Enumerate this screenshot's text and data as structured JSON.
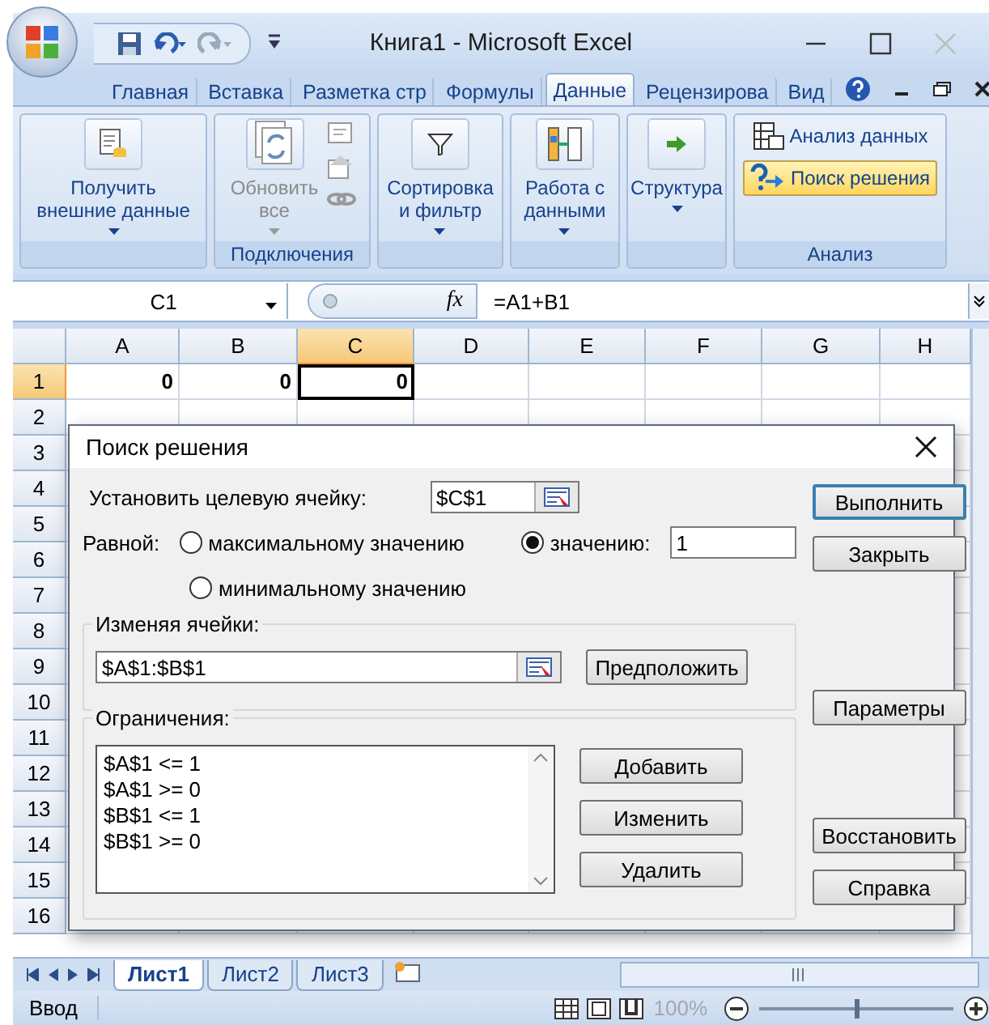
{
  "window": {
    "title": "Книга1 - Microsoft Excel"
  },
  "ribbon_tabs": [
    {
      "label": "Главная",
      "selected": false
    },
    {
      "label": "Вставка",
      "selected": false
    },
    {
      "label": "Разметка стр",
      "selected": false
    },
    {
      "label": "Формулы",
      "selected": false
    },
    {
      "label": "Данные",
      "selected": true
    },
    {
      "label": "Рецензирова",
      "selected": false
    },
    {
      "label": "Вид",
      "selected": false
    }
  ],
  "ribbon_groups": [
    {
      "items": [
        {
          "kind": "large",
          "label": "Получить\nвнешние данные",
          "dropdown": true,
          "disabled": false
        }
      ]
    },
    {
      "label": "Подключения",
      "items": [
        {
          "kind": "large",
          "label": "Обновить\nвсе",
          "dropdown": true,
          "disabled": true
        },
        {
          "kind": "icons"
        }
      ]
    },
    {
      "items": [
        {
          "kind": "large",
          "label": "Сортировка\nи фильтр",
          "dropdown": true,
          "disabled": false
        }
      ]
    },
    {
      "items": [
        {
          "kind": "large",
          "label": "Работа с\nданными",
          "dropdown": true,
          "disabled": false
        }
      ]
    },
    {
      "items": [
        {
          "kind": "large",
          "label": "Структура",
          "dropdown": true,
          "disabled": false
        }
      ]
    },
    {
      "label": "Анализ",
      "items": [
        {
          "kind": "small",
          "label": "Анализ данных",
          "highlighted": false
        },
        {
          "kind": "small",
          "label": "Поиск решения",
          "highlighted": true
        }
      ]
    }
  ],
  "formula_bar": {
    "name_box": "C1",
    "fx": "fx",
    "formula": "=A1+B1"
  },
  "columns": [
    {
      "label": "A",
      "selected": false
    },
    {
      "label": "B",
      "selected": false
    },
    {
      "label": "C",
      "selected": true
    },
    {
      "label": "D",
      "selected": false
    },
    {
      "label": "E",
      "selected": false
    },
    {
      "label": "F",
      "selected": false
    },
    {
      "label": "G",
      "selected": false
    },
    {
      "label": "H",
      "selected": false
    }
  ],
  "rows": [
    {
      "label": "1",
      "selected": true,
      "cells": [
        {
          "value": "0",
          "active": false
        },
        {
          "value": "0",
          "active": false
        },
        {
          "value": "0",
          "active": true
        }
      ]
    },
    {
      "label": "2",
      "selected": false
    },
    {
      "label": "3",
      "selected": false
    },
    {
      "label": "4",
      "selected": false
    },
    {
      "label": "5",
      "selected": false
    },
    {
      "label": "6",
      "selected": false
    },
    {
      "label": "7",
      "selected": false
    },
    {
      "label": "8",
      "selected": false
    },
    {
      "label": "9",
      "selected": false
    },
    {
      "label": "10",
      "selected": false
    },
    {
      "label": "11",
      "selected": false
    },
    {
      "label": "12",
      "selected": false
    },
    {
      "label": "13",
      "selected": false
    },
    {
      "label": "14",
      "selected": false
    },
    {
      "label": "15",
      "selected": false
    },
    {
      "label": "16",
      "selected": false
    }
  ],
  "sheet_tabs": [
    {
      "label": "Лист1",
      "selected": true
    },
    {
      "label": "Лист2",
      "selected": false
    },
    {
      "label": "Лист3",
      "selected": false
    }
  ],
  "status_bar": {
    "mode": "Ввод",
    "zoom": {
      "label": "100%",
      "level": 0.5
    }
  },
  "dialog": {
    "title": "Поиск решения",
    "target_label": "Установить целевую ячейку:",
    "target_value": "$C$1",
    "equal_label": "Равной:",
    "options": [
      {
        "label": "максимальному значению",
        "selected": false
      },
      {
        "label": "значению:",
        "selected": true
      },
      {
        "label": "минимальному значению",
        "selected": false
      }
    ],
    "value": "1",
    "changing_label": "Изменяя ячейки:",
    "changing_value": "$A$1:$B$1",
    "guess_button": "Предположить",
    "constraints_label": "Ограничения:",
    "constraints": [
      "$A$1 <= 1",
      "$A$1 >= 0",
      "$B$1 <= 1",
      "$B$1 >= 0"
    ],
    "constraint_buttons": [
      "Добавить",
      "Изменить",
      "Удалить"
    ],
    "side_button_groups": [
      [
        {
          "label": "Выполнить",
          "default": true
        },
        {
          "label": "Закрыть",
          "default": false
        }
      ],
      [
        {
          "label": "Параметры",
          "default": false
        }
      ],
      [
        {
          "label": "Восстановить",
          "default": false
        },
        {
          "label": "Справка",
          "default": false
        }
      ]
    ]
  }
}
